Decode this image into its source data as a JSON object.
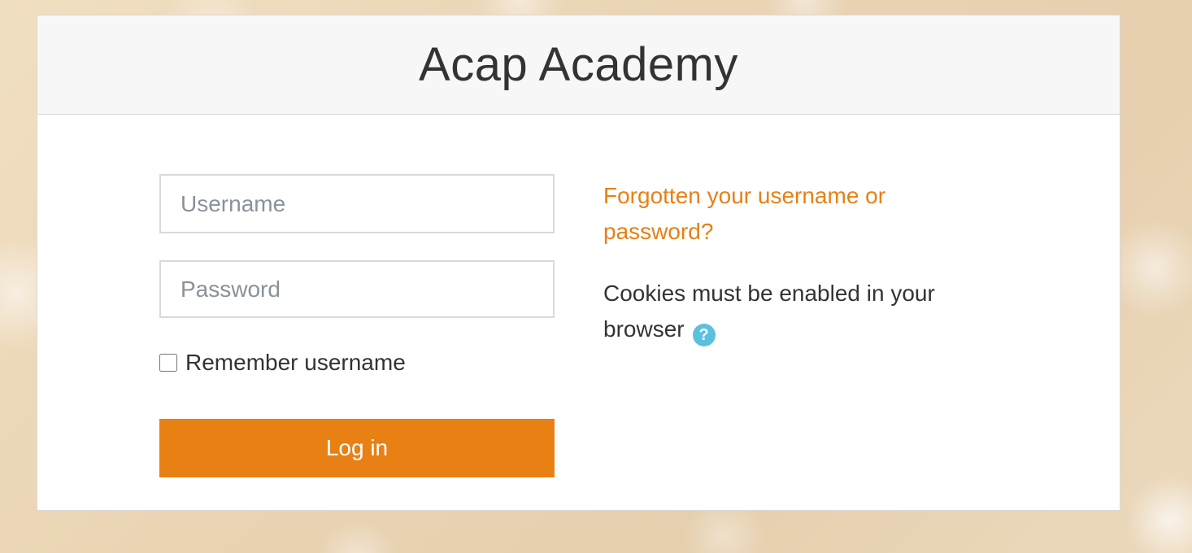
{
  "site": {
    "title": "Acap Academy"
  },
  "login_form": {
    "username_placeholder": "Username",
    "password_placeholder": "Password",
    "remember_label": "Remember username",
    "login_button_label": "Log in"
  },
  "info": {
    "forgot_link_text": "Forgotten your username or password?",
    "cookies_text": "Cookies must be enabled in your browser",
    "help_icon_glyph": "?",
    "help_icon_name": "help-icon"
  },
  "colors": {
    "accent": "#e98014",
    "help_icon": "#5bc0de",
    "header_bg": "#f7f7f7"
  }
}
